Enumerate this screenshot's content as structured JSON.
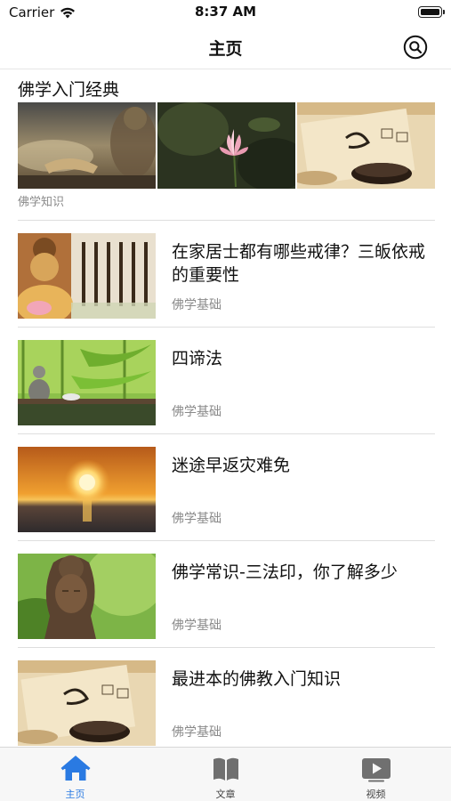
{
  "status_bar": {
    "carrier": "Carrier",
    "time": "8:37 AM"
  },
  "nav": {
    "title": "主页",
    "search_icon": "search-icon"
  },
  "section": {
    "title": "佛学入门经典",
    "caption": "佛学知识"
  },
  "banners": [
    {
      "name": "banner-buddha-hands-image"
    },
    {
      "name": "banner-lotus-image"
    },
    {
      "name": "banner-calligraphy-tea-image"
    }
  ],
  "articles": [
    {
      "title": "在家居士都有哪些戒律？三皈依戒的重要性",
      "category": "佛学基础",
      "thumb": "buddha-calligraphy"
    },
    {
      "title": "四谛法",
      "category": "佛学基础",
      "thumb": "bamboo-buddha"
    },
    {
      "title": "迷途早返灾难免",
      "category": "佛学基础",
      "thumb": "sunset-sea"
    },
    {
      "title": "佛学常识-三法印，你了解多少",
      "category": "佛学基础",
      "thumb": "buddha-head"
    },
    {
      "title": "最进本的佛教入门知识",
      "category": "佛学基础",
      "thumb": "calligraphy-tea"
    }
  ],
  "tabs": [
    {
      "label": "主页",
      "icon": "home-icon",
      "active": true
    },
    {
      "label": "文章",
      "icon": "book-icon",
      "active": false
    },
    {
      "label": "视频",
      "icon": "video-play-icon",
      "active": false
    }
  ],
  "colors": {
    "accent": "#2a7ae2",
    "secondary_text": "#8a8a8a"
  }
}
